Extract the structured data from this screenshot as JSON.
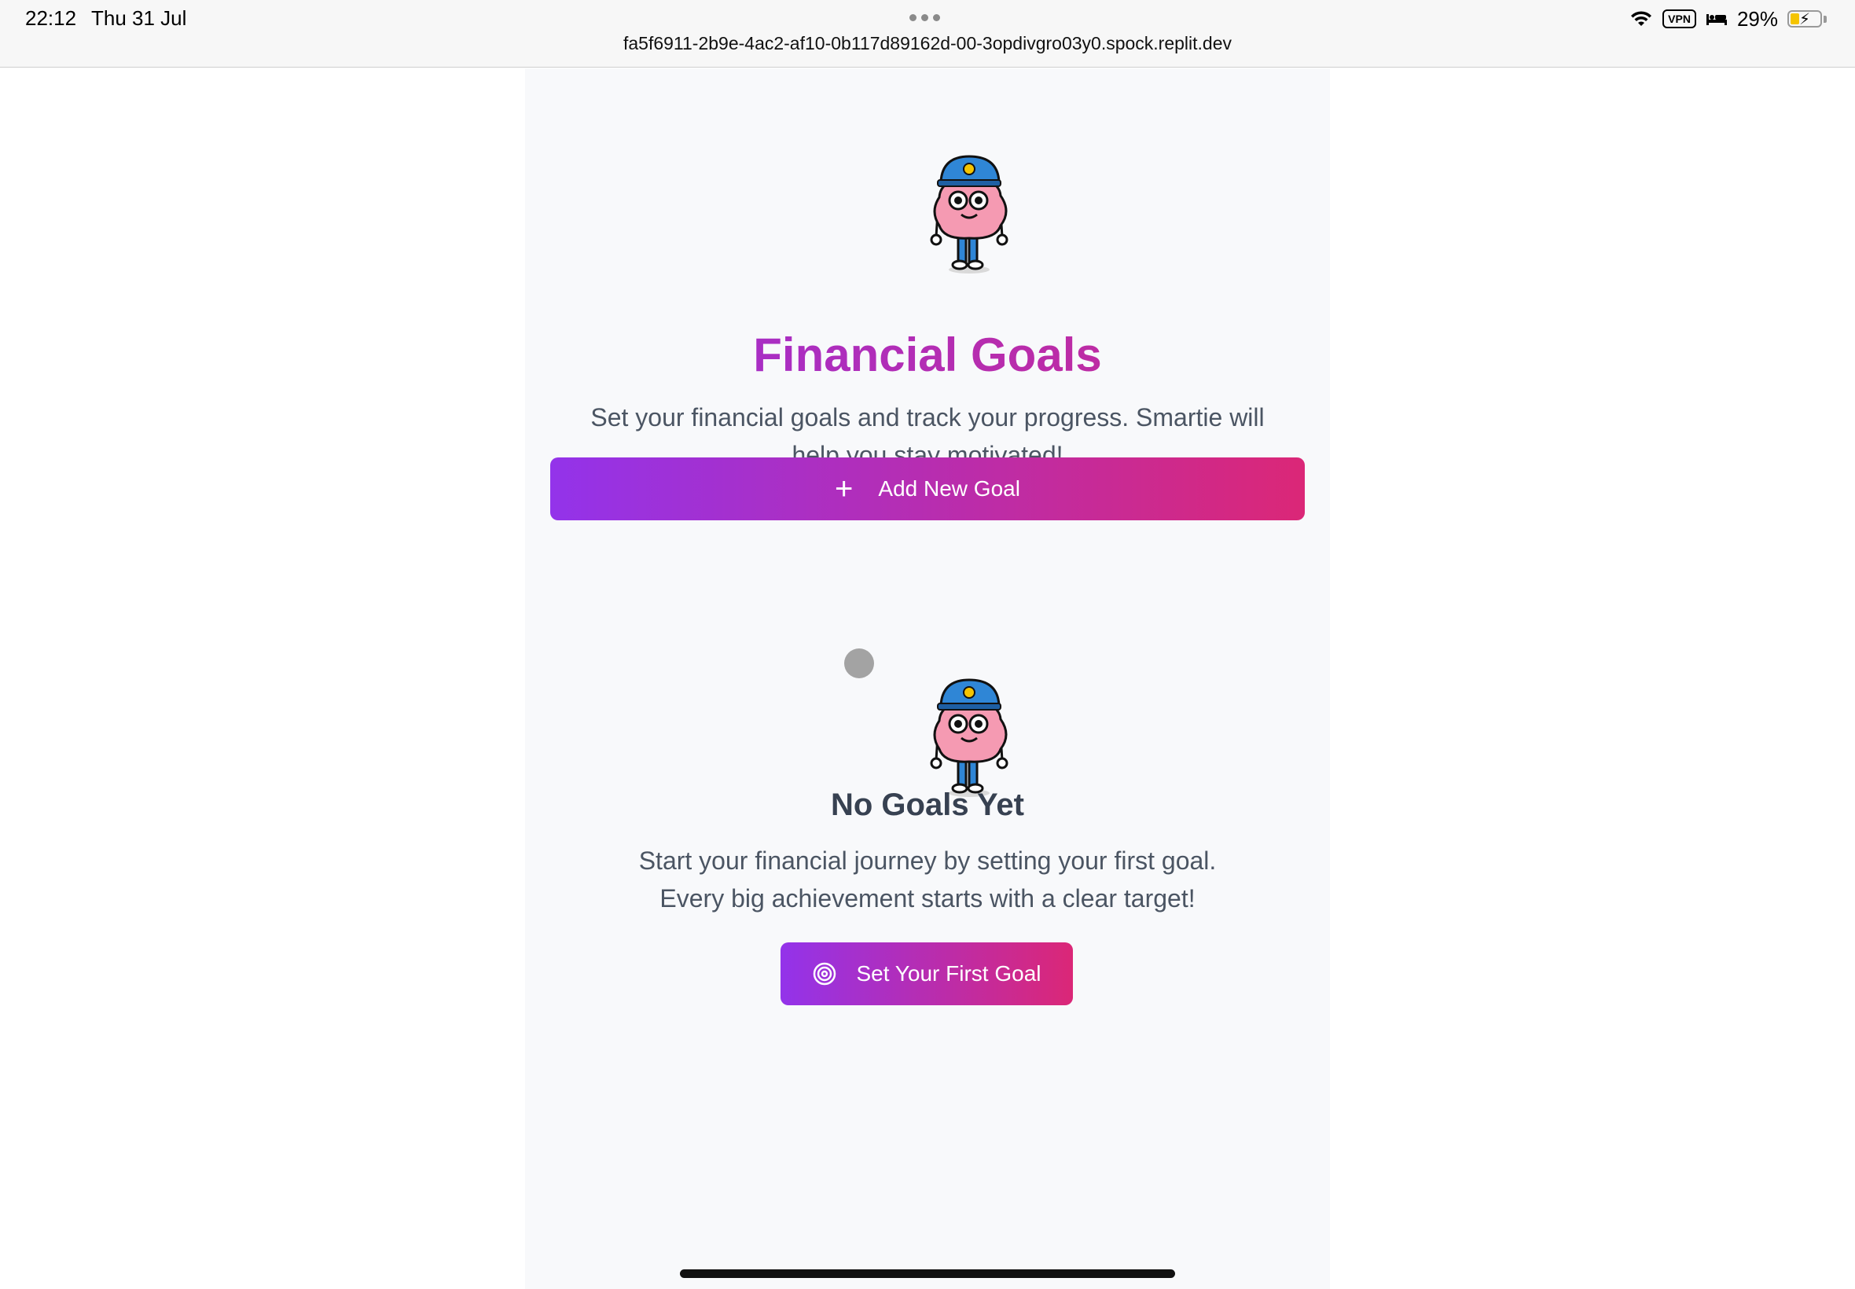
{
  "status_bar": {
    "time": "22:12",
    "date": "Thu 31 Jul",
    "url": "fa5f6911-2b9e-4ac2-af10-0b117d89162d-00-3opdivgro03y0.spock.replit.dev",
    "vpn": "VPN",
    "battery_percent": "29%",
    "battery_level": 0.29,
    "icons": [
      "wifi-icon",
      "vpn-icon",
      "sleep-mode-icon",
      "battery-charging-icon"
    ]
  },
  "page": {
    "title": "Financial Goals",
    "subtitle": "Set your financial goals and track your progress. Smartie will help you stay motivated!",
    "add_button_label": "Add New Goal",
    "add_button_icon": "plus-icon"
  },
  "empty_state": {
    "title": "No Goals Yet",
    "line1": "Start your financial journey by setting your first goal.",
    "line2": "Every big achievement starts with a clear target!",
    "cta_label": "Set Your First Goal",
    "cta_icon": "target-icon"
  },
  "colors": {
    "gradient_start": "#9333ea",
    "gradient_end": "#db2777",
    "text_muted": "#4b5563",
    "heading_dark": "#374151",
    "content_bg": "#f8f9fb"
  },
  "mascot": {
    "name": "Smartie",
    "icon": "brain-mascot-icon"
  }
}
